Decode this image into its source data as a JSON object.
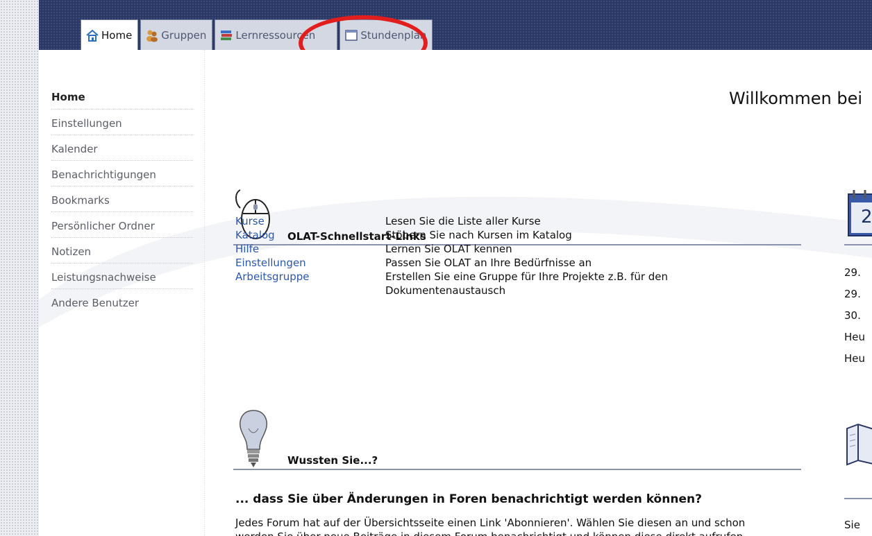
{
  "tabs": [
    {
      "label": "Home",
      "icon": "home-icon",
      "active": true
    },
    {
      "label": "Gruppen",
      "icon": "group-icon"
    },
    {
      "label": "Lernressourcen",
      "icon": "books-icon"
    },
    {
      "label": "Stundenplan",
      "icon": "window-icon"
    }
  ],
  "sidebar": {
    "items": [
      {
        "label": "Home"
      },
      {
        "label": "Einstellungen"
      },
      {
        "label": "Kalender"
      },
      {
        "label": "Benachrichtigungen"
      },
      {
        "label": "Bookmarks"
      },
      {
        "label": "Persönlicher Ordner"
      },
      {
        "label": "Notizen"
      },
      {
        "label": "Leistungsnachweise"
      },
      {
        "label": "Andere Benutzer"
      }
    ]
  },
  "main": {
    "welcome": "Willkommen bei",
    "quicklinks": {
      "title": "OLAT-Schnellstart-Links",
      "rows": [
        {
          "link": "Kurse",
          "desc": "Lesen Sie die Liste aller Kurse"
        },
        {
          "link": "Katalog",
          "desc": "Stöbern Sie nach Kursen im Katalog"
        },
        {
          "link": "Hilfe",
          "desc": "Lernen Sie OLAT kennen"
        },
        {
          "link": "Einstellungen",
          "desc": "Passen Sie OLAT an Ihre Bedürfnisse an"
        },
        {
          "link": "Arbeitsgruppe",
          "desc": "Erstellen Sie eine Gruppe für Ihre Projekte z.B. für den Dokumentenaustausch"
        }
      ]
    },
    "tips": {
      "title": "Wussten Sie...?",
      "heading": "... dass Sie über Änderungen in Foren benachrichtigt werden können?",
      "text": "Jedes Forum hat auf der Übersichtsseite einen Link 'Abonnieren'. Wählen Sie diesen an und schon",
      "text2": "werden Sie über neue Beiträge in diesem Forum benachrichtigt und können diese direkt aufrufen."
    }
  },
  "right_column": {
    "calendar_day": "2",
    "dates": [
      "29.",
      "29.",
      "30.",
      "Heu",
      "Heu"
    ],
    "bottom_text": "Sie"
  },
  "colors": {
    "topbar": "#2a3763",
    "link": "#2a57b0",
    "highlight_ring": "#e11d1d",
    "divider": "#8b92ad"
  }
}
